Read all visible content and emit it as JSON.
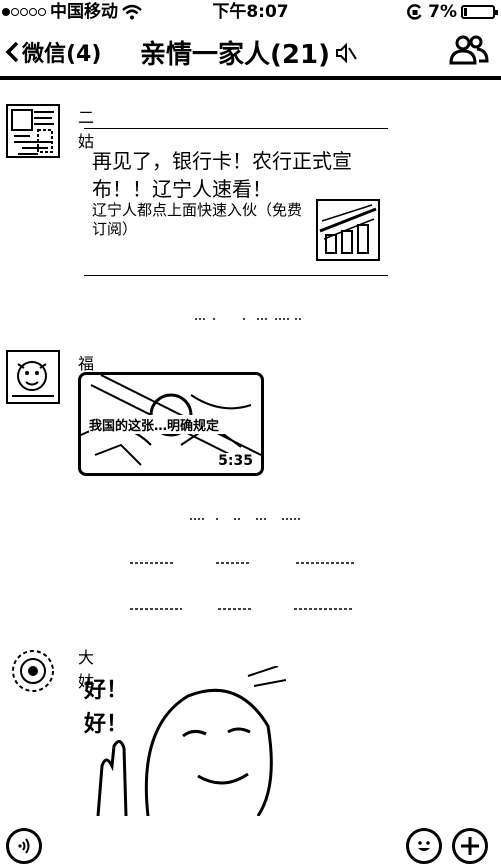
{
  "status_bar": {
    "carrier": "中国移动",
    "time": "下午8:07",
    "battery_percent": "7%"
  },
  "nav": {
    "back_label": "微信(4)",
    "title": "亲情一家人(21)"
  },
  "messages": [
    {
      "sender": "二姑",
      "type": "article",
      "title": "再见了，银行卡！农行正式宣布！！辽宁人速看！",
      "description": "辽宁人都点上面快速入伙（免费订阅）"
    },
    {
      "sender": "福缘",
      "type": "video",
      "caption": "我国的这张…明确规定",
      "duration": "5:35"
    },
    {
      "sender": "大姑",
      "type": "sticker",
      "sticker_lines": [
        "好！",
        "好！"
      ]
    }
  ],
  "system_notes": [
    "",
    ""
  ],
  "input_bar": {
    "voice_icon": "voice-icon",
    "emoji_icon": "emoji-icon",
    "plus_icon": "plus-icon"
  }
}
